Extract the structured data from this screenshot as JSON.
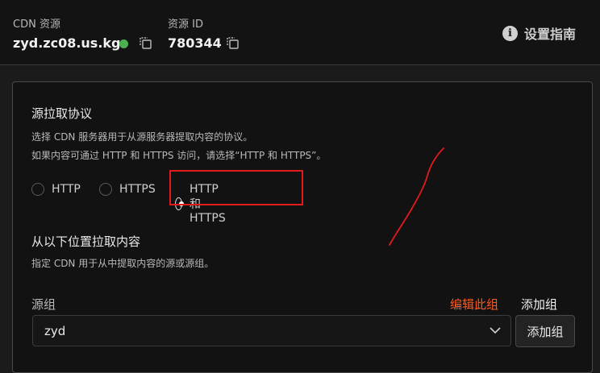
{
  "header": {
    "cdn_resource_label": "CDN 资源",
    "cdn_resource_value": "zyd.zc08.us.kg",
    "resource_id_label": "资源 ID",
    "resource_id_value": "780344",
    "guide_label": "设置指南",
    "status_color": "#4caf50"
  },
  "protocol": {
    "title": "源拉取协议",
    "desc_line1": "选择 CDN 服务器用于从源服务器提取内容的协议。",
    "desc_line2": "如果内容可通过 HTTP 和 HTTPS 访问，请选择“HTTP 和 HTTPS”。",
    "options": [
      {
        "label": "HTTP",
        "checked": false
      },
      {
        "label": "HTTPS",
        "checked": false
      },
      {
        "label": "HTTP 和 HTTPS",
        "checked": true
      }
    ]
  },
  "pull": {
    "title": "从以下位置拉取内容",
    "desc": "指定 CDN 用于从中提取内容的源或源组。"
  },
  "origin_group": {
    "label": "源组",
    "edit_link": "编辑此组",
    "add_link": "添加组",
    "selected": "zyd",
    "add_button": "添加组"
  },
  "annotation_color": "#e21a1a"
}
